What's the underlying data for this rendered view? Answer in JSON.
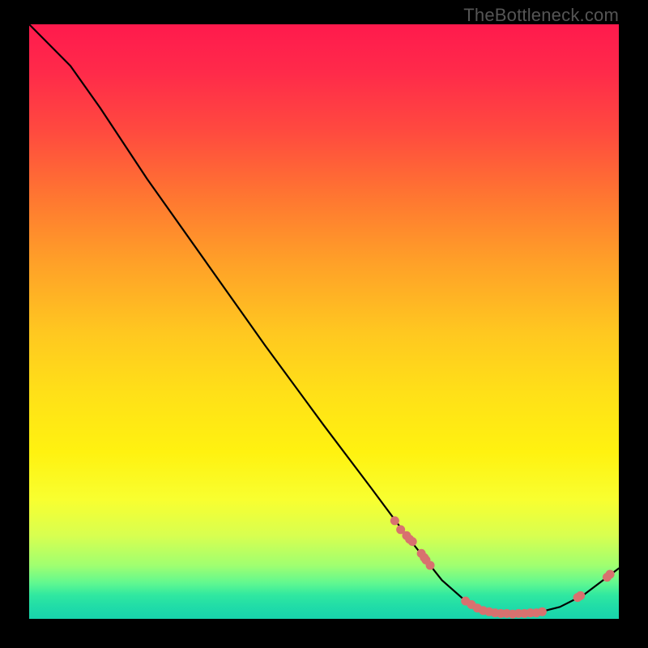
{
  "watermark": "TheBottleneck.com",
  "colors": {
    "curve": "#000000",
    "markers": "#d8716f",
    "background": "#000000"
  },
  "chart_data": {
    "type": "line",
    "title": "",
    "xlabel": "",
    "ylabel": "",
    "xlim": [
      0,
      100
    ],
    "ylim": [
      0,
      100
    ],
    "grid": false,
    "legend": false,
    "curve": [
      {
        "x": 0,
        "y": 100
      },
      {
        "x": 3,
        "y": 97
      },
      {
        "x": 7,
        "y": 93
      },
      {
        "x": 12,
        "y": 86
      },
      {
        "x": 20,
        "y": 74
      },
      {
        "x": 30,
        "y": 60
      },
      {
        "x": 40,
        "y": 46
      },
      {
        "x": 50,
        "y": 32.5
      },
      {
        "x": 58,
        "y": 22
      },
      {
        "x": 64,
        "y": 14
      },
      {
        "x": 70,
        "y": 6.5
      },
      {
        "x": 74,
        "y": 3
      },
      {
        "x": 78,
        "y": 1.2
      },
      {
        "x": 82,
        "y": 0.8
      },
      {
        "x": 86,
        "y": 1.0
      },
      {
        "x": 90,
        "y": 2.0
      },
      {
        "x": 94,
        "y": 4.0
      },
      {
        "x": 98,
        "y": 7.0
      },
      {
        "x": 100,
        "y": 8.5
      }
    ],
    "markers": [
      {
        "x": 62,
        "y": 16.5
      },
      {
        "x": 63,
        "y": 15.0
      },
      {
        "x": 64,
        "y": 14.0
      },
      {
        "x": 64.5,
        "y": 13.4
      },
      {
        "x": 65,
        "y": 13.0
      },
      {
        "x": 66.5,
        "y": 11.0
      },
      {
        "x": 67,
        "y": 10.3
      },
      {
        "x": 67.3,
        "y": 9.9
      },
      {
        "x": 68,
        "y": 9.0
      },
      {
        "x": 74,
        "y": 3.0
      },
      {
        "x": 75,
        "y": 2.4
      },
      {
        "x": 76,
        "y": 1.8
      },
      {
        "x": 77,
        "y": 1.4
      },
      {
        "x": 78,
        "y": 1.2
      },
      {
        "x": 79,
        "y": 1.0
      },
      {
        "x": 80,
        "y": 0.9
      },
      {
        "x": 81,
        "y": 0.9
      },
      {
        "x": 82,
        "y": 0.8
      },
      {
        "x": 83,
        "y": 0.9
      },
      {
        "x": 84,
        "y": 0.9
      },
      {
        "x": 85,
        "y": 1.0
      },
      {
        "x": 86,
        "y": 1.0
      },
      {
        "x": 87,
        "y": 1.2
      },
      {
        "x": 93,
        "y": 3.6
      },
      {
        "x": 93.5,
        "y": 3.9
      },
      {
        "x": 98,
        "y": 7.0
      },
      {
        "x": 98.5,
        "y": 7.5
      }
    ],
    "note": "No axis tick labels visible; values are estimated on a 0–100 normalized scale."
  }
}
